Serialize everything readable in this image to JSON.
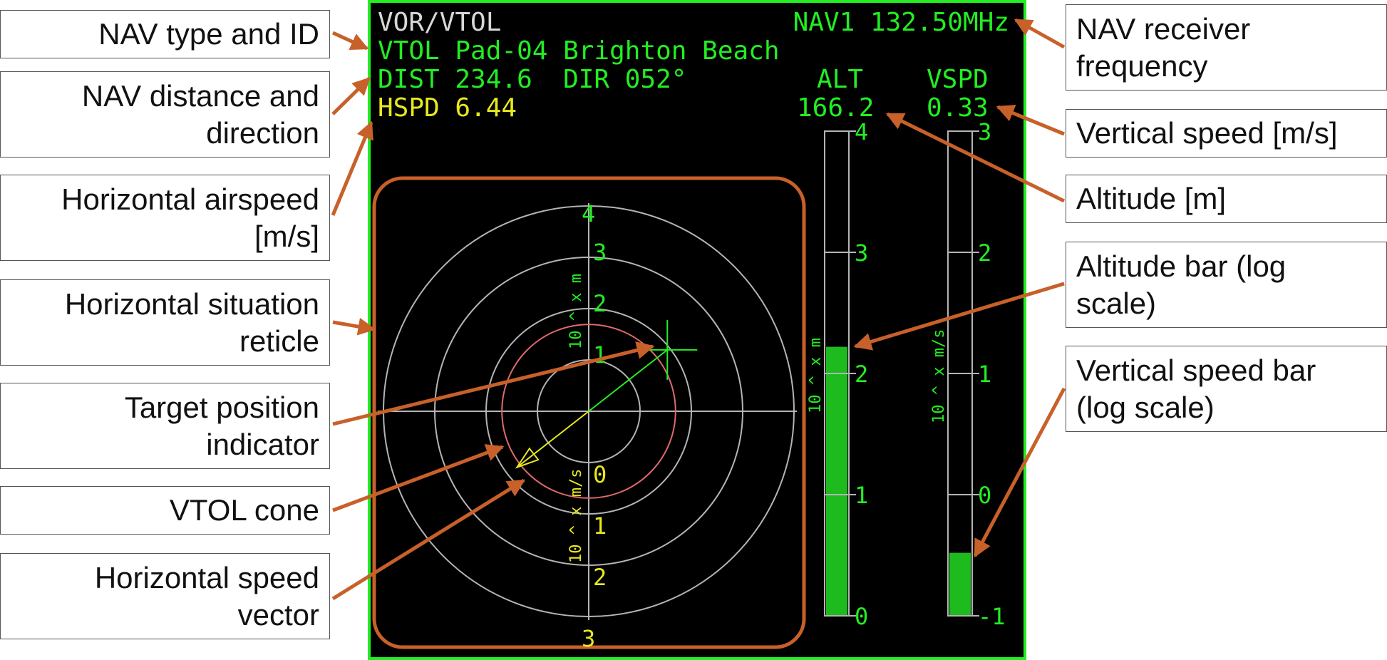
{
  "colors": {
    "mfd_bg": "#000000",
    "mfd_border": "#22ee22",
    "mfd_green": "#22ee22",
    "mfd_yellow": "#e8e820",
    "mfd_white": "#d8d8d8",
    "reticle_grey": "#b4b4b4",
    "reticle_red": "#e06a6a",
    "annotation": "#c8602a",
    "bar_fill": "#1dbb1d"
  },
  "labels_left": [
    {
      "text": "NAV type and ID"
    },
    {
      "text": "NAV distance and\ndirection"
    },
    {
      "text": "Horizontal airspeed\n[m/s]"
    },
    {
      "text": "Horizontal situation\nreticle"
    },
    {
      "text": "Target position\nindicator"
    },
    {
      "text": "VTOL cone"
    },
    {
      "text": "Horizontal speed\nvector"
    }
  ],
  "labels_right": [
    {
      "text": "NAV receiver\nfrequency"
    },
    {
      "text": "Vertical speed [m/s]"
    },
    {
      "text": "Altitude [m]"
    },
    {
      "text": "Altitude bar (log\nscale)"
    },
    {
      "text": "Vertical speed bar\n(log scale)"
    }
  ],
  "mfd": {
    "nav_type": "VOR/VTOL",
    "nav_freq": "NAV1 132.50MHz",
    "nav_id": "VTOL Pad-04 Brighton Beach",
    "dist_dir": "DIST 234.6  DIR 052°",
    "alt_label": "ALT",
    "vspd_label": "VSPD",
    "hspd": "HSPD 6.44",
    "alt_value": "166.2",
    "vspd_value": "0.33",
    "reticle": {
      "top_ticks": [
        "4",
        "3",
        "2",
        "1"
      ],
      "bottom_ticks": [
        "0",
        "1",
        "2",
        "3"
      ],
      "top_unit": "10 ^ x m",
      "bottom_unit": "10 ^ x m/s",
      "target_log_distance": 2.37,
      "target_bearing_deg": 52,
      "speed_log": 0.81,
      "speed_bearing_deg": 232
    },
    "alt_bar": {
      "ticks": [
        "4",
        "3",
        "2",
        "1",
        "0"
      ],
      "unit": "10 ^ x m",
      "min": 0,
      "max": 4,
      "value": 2.22
    },
    "vspd_bar": {
      "ticks": [
        "3",
        "2",
        "1",
        "0",
        "-1"
      ],
      "unit": "10 ^ x m/s",
      "min": -1,
      "max": 3,
      "value": -0.48
    }
  }
}
